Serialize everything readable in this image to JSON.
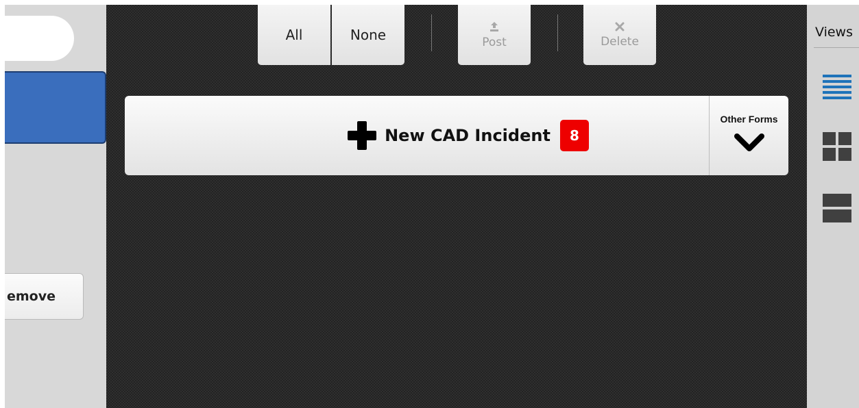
{
  "sidebar": {
    "remove_label": "emove"
  },
  "toolbar": {
    "all_label": "All",
    "none_label": "None",
    "post_label": "Post",
    "delete_label": "Delete"
  },
  "form": {
    "new_label": "New CAD Incident",
    "badge_count": "8",
    "other_forms_label": "Other Forms"
  },
  "views": {
    "label": "Views"
  },
  "colors": {
    "selected_blue": "#3a6ebd",
    "badge_red": "#ee0000",
    "list_view_blue": "#1e73b9"
  }
}
